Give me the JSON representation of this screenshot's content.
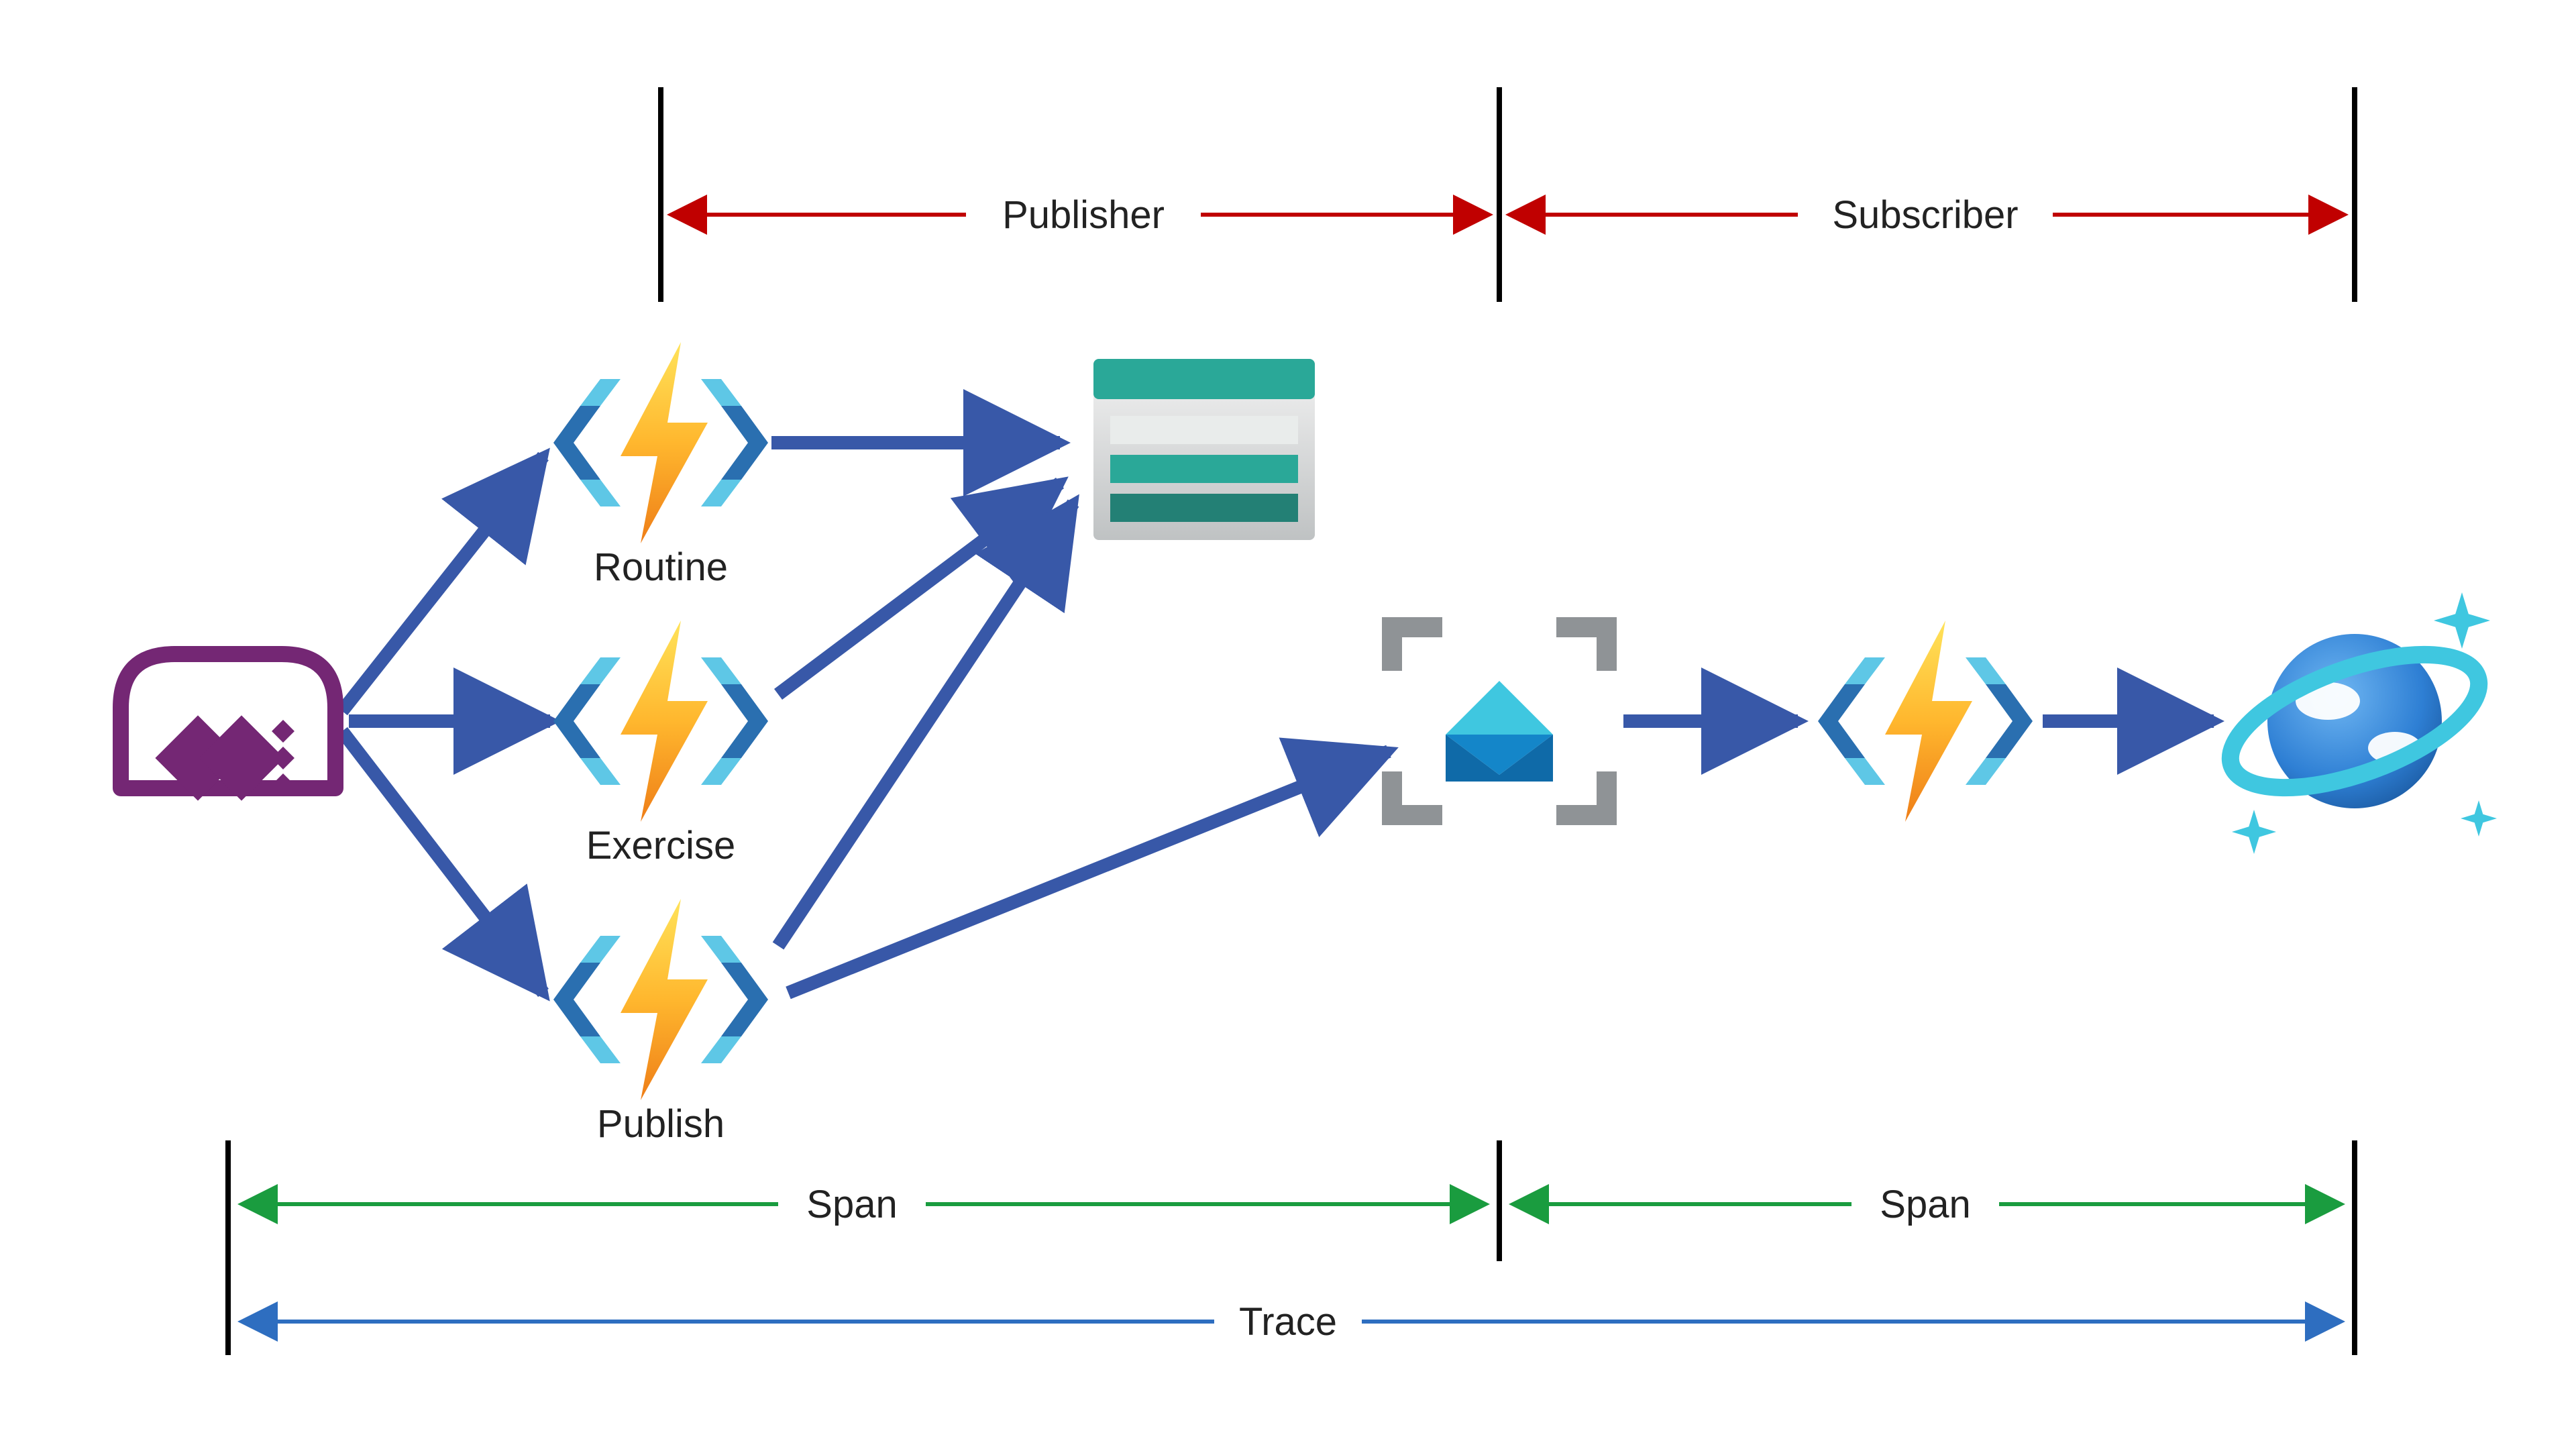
{
  "topDimensions": {
    "left": {
      "label": "Publisher"
    },
    "right": {
      "label": "Subscriber"
    }
  },
  "bottomDimensions": {
    "span1": {
      "label": "Span"
    },
    "span2": {
      "label": "Span"
    },
    "trace": {
      "label": "Trace"
    }
  },
  "functions": {
    "routine": {
      "label": "Routine"
    },
    "exercise": {
      "label": "Exercise"
    },
    "publish": {
      "label": "Publish"
    }
  },
  "colors": {
    "flowArrow": "#3858a8",
    "topDim": "#c00000",
    "spanDim": "#1a9c3f",
    "traceDim": "#2e6ec0",
    "tick": "#000000",
    "powerapps": "#742774",
    "funcBracketDark": "#2a6fb0",
    "funcBracketLight": "#5ec7e6",
    "boltTop": "#ffd84a",
    "boltBot": "#f08a1d",
    "storageBar": "#2aa898",
    "storageBar2": "#238075",
    "storageBG": "#d9dbdc",
    "svcBusFrame": "#8f9396",
    "envTop": "#3fc7e0",
    "envBot": "#0f6aa8",
    "globe": "#2e7fd4",
    "globeRing": "#3fc7e0",
    "cloud": "#ffffff"
  }
}
